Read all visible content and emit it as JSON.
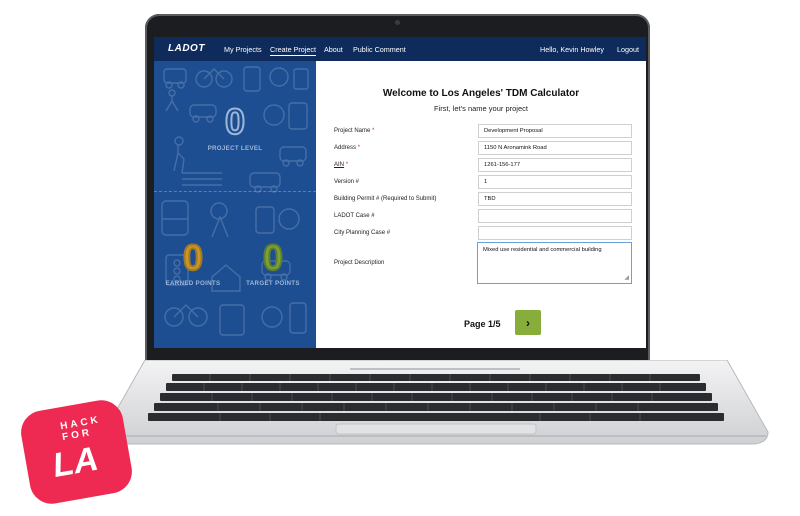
{
  "nav": {
    "logo": "LADOT",
    "links": [
      "My Projects",
      "Create Project",
      "About",
      "Public Comment"
    ],
    "greeting": "Hello, Kevin Howley",
    "logout": "Logout"
  },
  "panel": {
    "project_level": {
      "value": "0",
      "label": "PROJECT LEVEL"
    },
    "earned_points": {
      "value": "0",
      "label": "EARNED POINTS",
      "color": "#c8962a"
    },
    "target_points": {
      "value": "0",
      "label": "TARGET POINTS",
      "color": "#7aa23a"
    }
  },
  "form": {
    "title": "Welcome to Los Angeles' TDM Calculator",
    "subtitle": "First, let's name your project",
    "fields": [
      {
        "label": "Project Name",
        "required": "*",
        "value": "Development Proposal"
      },
      {
        "label": "Address",
        "required": "*",
        "value": "1150 N Aronamink Road"
      },
      {
        "label": "AIN",
        "required": "*",
        "value": "1261-156-177"
      },
      {
        "label": "Version #",
        "required": "",
        "value": "1"
      },
      {
        "label": "Building Permit # (Required to Submit)",
        "required": "",
        "value": "TBD"
      },
      {
        "label": "LADOT Case #",
        "required": "",
        "value": ""
      },
      {
        "label": "City Planning Case #",
        "required": "",
        "value": ""
      }
    ],
    "description": {
      "label": "Project Description",
      "value": "Mixed use residential and commercial building"
    },
    "page": "Page 1/5",
    "next_icon": "chevron-right-icon"
  },
  "badge": {
    "line1": "HACK",
    "line2": "FOR",
    "logo": "LA"
  },
  "colors": {
    "nav_bg": "#0f2b5c",
    "panel_bg": "#1d4e92",
    "next_button": "#87ad3a",
    "badge": "#ee2a53"
  }
}
